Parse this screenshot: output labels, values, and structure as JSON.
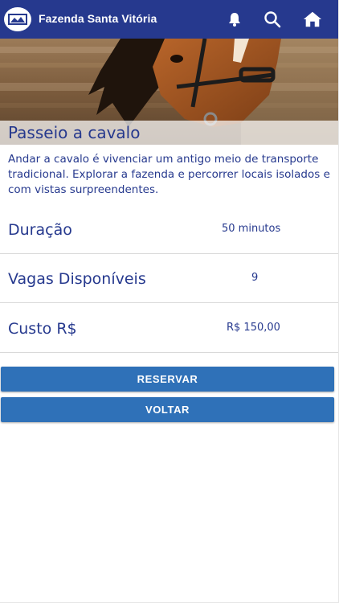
{
  "app": {
    "title": "Fazenda Santa Vitória"
  },
  "header": {
    "icons": [
      "bell-icon",
      "search-icon",
      "home-icon"
    ]
  },
  "activity": {
    "title": "Passeio a cavalo",
    "description": "Andar a cavalo é vivenciar um antigo meio de transporte tradicional. Explorar a fazenda e percorrer locais isolados e com vistas surpreendentes.",
    "details": [
      {
        "label": "Duração",
        "value": "50 minutos"
      },
      {
        "label": "Vagas Disponíveis",
        "value": "9"
      },
      {
        "label": "Custo R$",
        "value": "R$ 150,00"
      }
    ]
  },
  "actions": {
    "reserve_label": "RESERVAR",
    "back_label": "VOLTAR"
  },
  "colors": {
    "appbar": "#26398e",
    "text": "#26398e",
    "button": "#2f71b8"
  }
}
